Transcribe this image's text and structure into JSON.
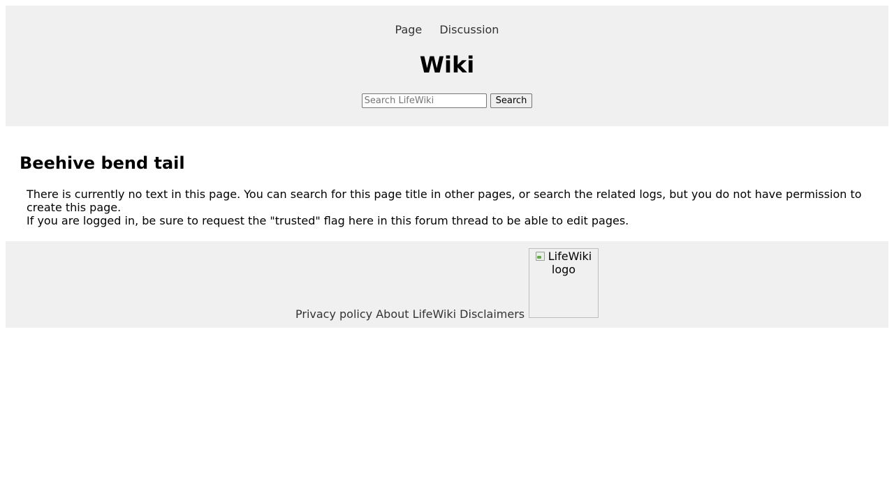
{
  "header": {
    "nav": {
      "page_label": "Page",
      "discussion_label": "Discussion"
    },
    "site_title": "Wiki",
    "search": {
      "placeholder": "Search LifeWiki",
      "value": "",
      "button_label": "Search"
    }
  },
  "main": {
    "page_title": "Beehive bend tail",
    "notice_line1": "There is currently no text in this page. You can search for this page title in other pages, or search the related logs, but you do not have permission to create this page.",
    "notice_line2": "If you are logged in, be sure to request the \"trusted\" flag here in this forum thread to be able to edit pages."
  },
  "footer": {
    "links": [
      "Privacy policy",
      "About LifeWiki",
      "Disclaimers"
    ],
    "logo_alt": "LifeWiki logo",
    "logo_icon": "broken-image-icon"
  },
  "colors": {
    "header_bg": "#f0f0f0",
    "footer_bg": "#f0f0f0",
    "link": "#333333"
  }
}
